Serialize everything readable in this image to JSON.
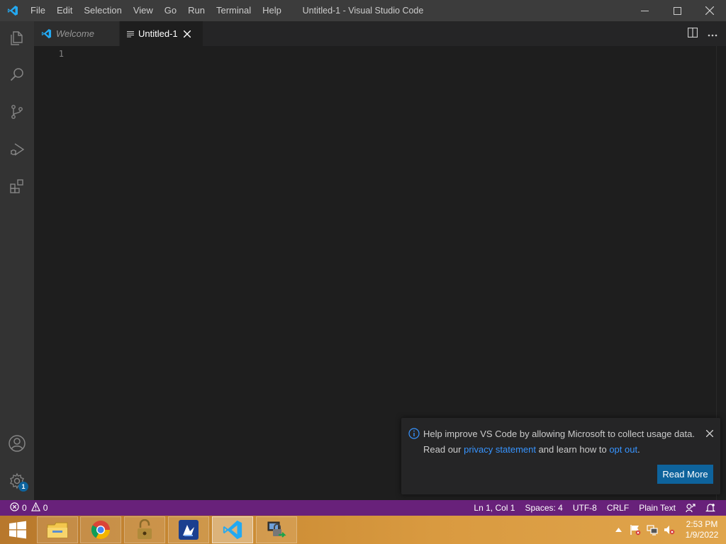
{
  "titlebar": {
    "menu": [
      "File",
      "Edit",
      "Selection",
      "View",
      "Go",
      "Run",
      "Terminal",
      "Help"
    ],
    "window_title": "Untitled-1 - Visual Studio Code"
  },
  "activitybar": {
    "items": [
      "explorer-icon",
      "search-icon",
      "source-control-icon",
      "run-debug-icon",
      "extensions-icon"
    ],
    "bottom": [
      "accounts-icon",
      "manage-gear-icon"
    ],
    "manage_badge": "1"
  },
  "tabs": [
    {
      "label": "Welcome",
      "icon": "vscode-logo-icon"
    },
    {
      "label": "Untitled-1",
      "icon": "file-lines-icon"
    }
  ],
  "editor": {
    "line_numbers": [
      "1"
    ]
  },
  "notification": {
    "line1": "Help improve VS Code by allowing Microsoft to collect usage data.",
    "line2_prefix": "Read our ",
    "link_privacy": "privacy statement",
    "line2_middle": " and learn how to ",
    "link_optout": "opt out",
    "line2_suffix": ".",
    "button": "Read More"
  },
  "statusbar": {
    "errors": "0",
    "warnings": "0",
    "position": "Ln 1, Col 1",
    "spaces": "Spaces: 4",
    "encoding": "UTF-8",
    "eol": "CRLF",
    "language": "Plain Text"
  },
  "taskbar": {
    "apps": [
      "file-explorer-icon",
      "chrome-icon",
      "unlocked-padlock-icon",
      "avast-pen-icon",
      "vscode-icon",
      "network-lock-icon"
    ],
    "time": "2:53 PM",
    "date": "1/9/2022"
  },
  "colors": {
    "statusbar": "#68217a",
    "accent_button": "#0e639c",
    "link": "#3794ff",
    "vscode_blue": "#23a9f2"
  }
}
